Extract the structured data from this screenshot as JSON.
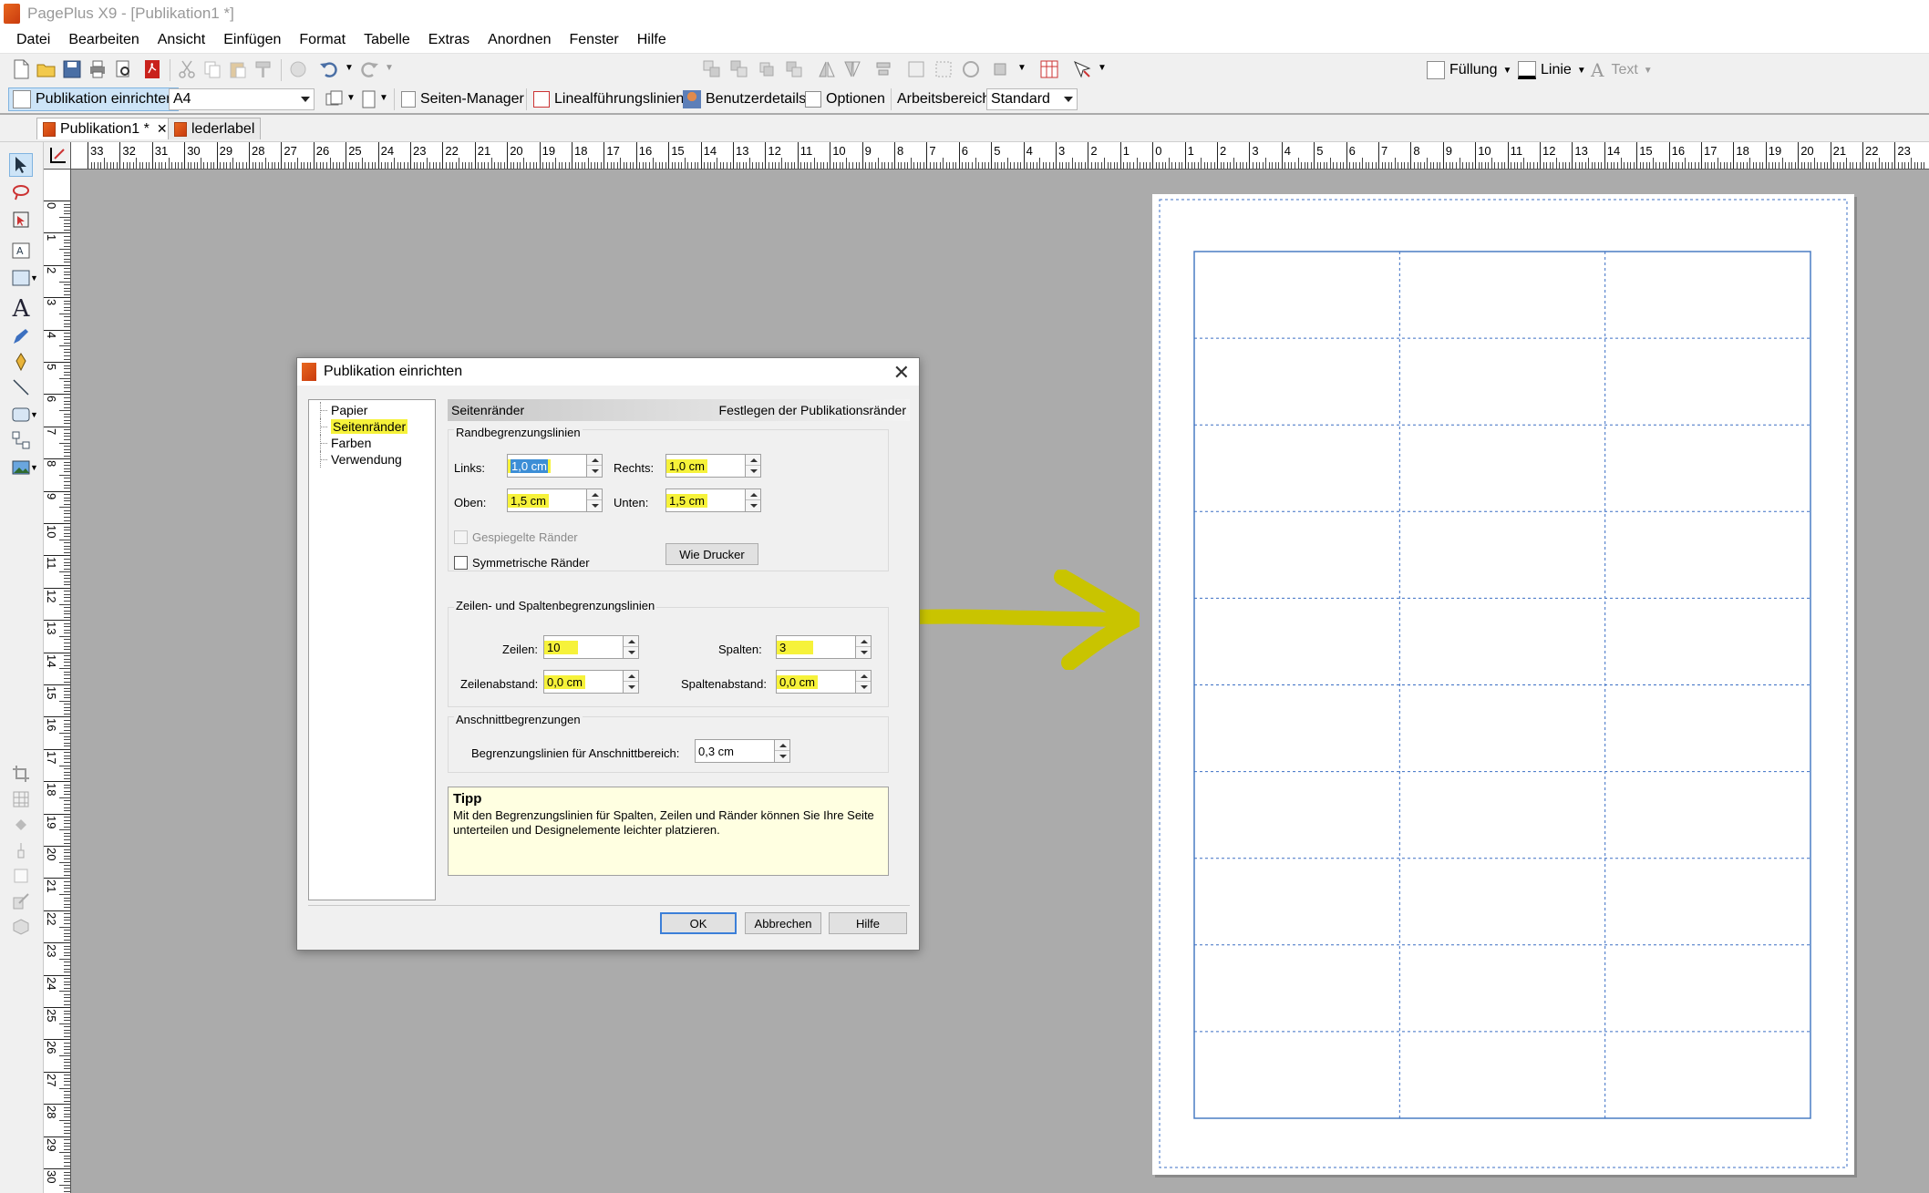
{
  "window": {
    "title": "PagePlus X9 - [Publikation1 *]"
  },
  "menu": [
    "Datei",
    "Bearbeiten",
    "Ansicht",
    "Einfügen",
    "Format",
    "Tabelle",
    "Extras",
    "Anordnen",
    "Fenster",
    "Hilfe"
  ],
  "toolbar_right": {
    "fill_label": "Füllung",
    "line_label": "Linie",
    "text_label": "Text"
  },
  "context_toolbar": {
    "setup_label": "Publikation einrichten",
    "paper_size": "A4",
    "pages_manager": "Seiten-Manager",
    "guides": "Linealführungslinien",
    "user_details": "Benutzerdetails",
    "options": "Optionen",
    "workspace_label": "Arbeitsbereich",
    "workspace_value": "Standard"
  },
  "tabs": [
    {
      "label": "Publikation1 *",
      "active": true
    },
    {
      "label": "lederlabel",
      "active": false
    }
  ],
  "ruler_h": [
    "33",
    "32",
    "31",
    "30",
    "29",
    "28",
    "27",
    "26",
    "25",
    "24",
    "23",
    "22",
    "21",
    "20",
    "19",
    "18",
    "17",
    "16",
    "15",
    "14",
    "13",
    "12",
    "11",
    "10",
    "9",
    "8",
    "7",
    "6",
    "5",
    "4",
    "3",
    "2",
    "1",
    "0",
    "1",
    "2",
    "3",
    "4",
    "5",
    "6",
    "7",
    "8",
    "9",
    "10",
    "11",
    "12",
    "13",
    "14",
    "15",
    "16",
    "17",
    "18",
    "19",
    "20",
    "21",
    "22",
    "23"
  ],
  "ruler_v": [
    "0",
    "1",
    "2",
    "3",
    "4",
    "5",
    "6",
    "7",
    "8",
    "9",
    "10",
    "11",
    "12",
    "13",
    "14",
    "15",
    "16",
    "17",
    "18",
    "19",
    "20",
    "21",
    "22",
    "23",
    "24",
    "25",
    "26",
    "27",
    "28",
    "29",
    "30"
  ],
  "dialog": {
    "title": "Publikation einrichten",
    "nav": [
      {
        "label": "Papier",
        "selected": false
      },
      {
        "label": "Seitenränder",
        "selected": true
      },
      {
        "label": "Farben",
        "selected": false
      },
      {
        "label": "Verwendung",
        "selected": false
      }
    ],
    "header_left": "Seitenränder",
    "header_right": "Festlegen der Publikationsränder",
    "margins": {
      "title": "Randbegrenzungslinien",
      "left_label": "Links:",
      "left_value": "1,0 cm",
      "right_label": "Rechts:",
      "right_value": "1,0 cm",
      "top_label": "Oben:",
      "top_value": "1,5 cm",
      "bottom_label": "Unten:",
      "bottom_value": "1,5 cm",
      "mirrored_label": "Gespiegelte Ränder",
      "symmetric_label": "Symmetrische Ränder",
      "printer_button": "Wie Drucker"
    },
    "grid": {
      "title": "Zeilen- und Spaltenbegrenzungslinien",
      "rows_label": "Zeilen:",
      "rows_value": "10",
      "cols_label": "Spalten:",
      "cols_value": "3",
      "row_gap_label": "Zeilenabstand:",
      "row_gap_value": "0,0 cm",
      "col_gap_label": "Spaltenabstand:",
      "col_gap_value": "0,0 cm"
    },
    "bleed": {
      "title": "Anschnittbegrenzungen",
      "label": "Begrenzungslinien für Anschnittbereich:",
      "value": "0,3 cm"
    },
    "tip": {
      "title": "Tipp",
      "text": "Mit den Begrenzungslinien für Spalten, Zeilen und Ränder können Sie Ihre Seite unterteilen und Designelemente leichter platzieren."
    },
    "buttons": {
      "ok": "OK",
      "cancel": "Abbrechen",
      "help": "Hilfe"
    }
  },
  "page_grid": {
    "rows": 10,
    "cols": 3
  },
  "colors": {
    "highlight": "#f6f23a",
    "arrow": "#c9c400",
    "guide": "#3b6fc4",
    "selection": "#3c8ed6"
  }
}
